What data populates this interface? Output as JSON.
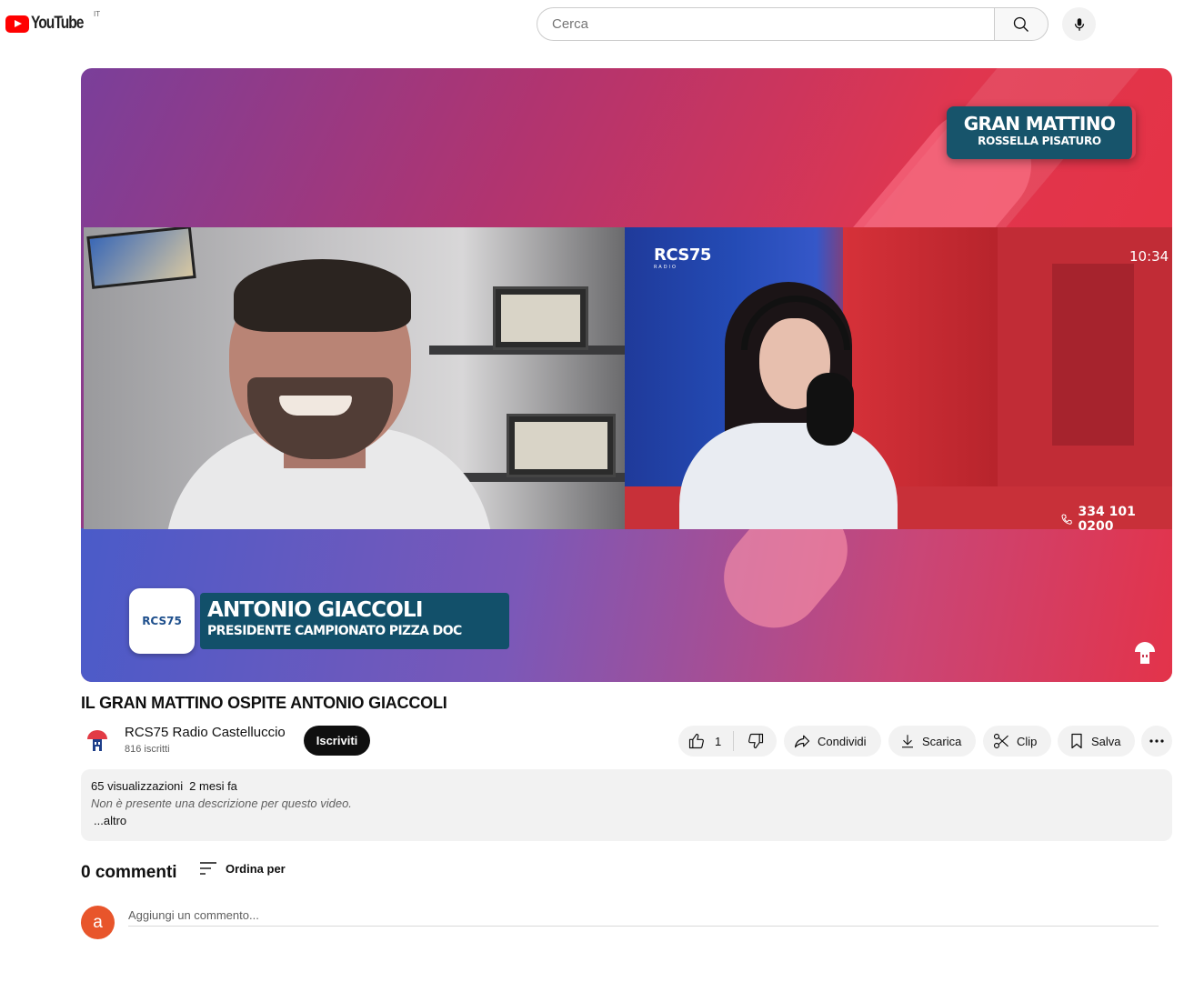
{
  "header": {
    "logo_text": "YouTube",
    "country_code": "IT",
    "search_placeholder": "Cerca",
    "icons": {
      "search": "search-icon",
      "mic": "microphone-icon"
    }
  },
  "video": {
    "overlay": {
      "show_title": "GRAN MATTINO",
      "show_host": "ROSSELLA PISATURO",
      "station_logo": "RCS75",
      "station_sub": "RADIO",
      "clock": "10:34",
      "phone": "334 101 0200",
      "guest_name": "ANTONIO GIACCOLI",
      "guest_role": "PRESIDENTE CAMPIONATO PIZZA DOC",
      "lower_logo": "RCS75"
    },
    "title": "IL GRAN MATTINO OSPITE ANTONIO GIACCOLI"
  },
  "channel": {
    "name": "RCS75 Radio Castelluccio",
    "subscribers": "816 iscritti",
    "subscribe_label": "Iscriviti"
  },
  "actions": {
    "like_count": "1",
    "share_label": "Condividi",
    "download_label": "Scarica",
    "clip_label": "Clip",
    "save_label": "Salva",
    "icons": [
      "like-icon",
      "dislike-icon",
      "share-icon",
      "download-icon",
      "clip-icon",
      "save-icon",
      "more-icon"
    ]
  },
  "description": {
    "views": "65 visualizzazioni",
    "date": "2 mesi fa",
    "text": "Non è presente una descrizione per questo video.",
    "more_label": "...altro"
  },
  "comments": {
    "count_label": "0 commenti",
    "sort_label": "Ordina per",
    "user_initial": "a",
    "input_placeholder": "Aggiungi un commento..."
  },
  "colors": {
    "brand_red": "#ff0000",
    "subscribe_bg": "#0f0f0f",
    "pill_bg": "#f2f2f2",
    "user_avatar": "#e8552b"
  }
}
